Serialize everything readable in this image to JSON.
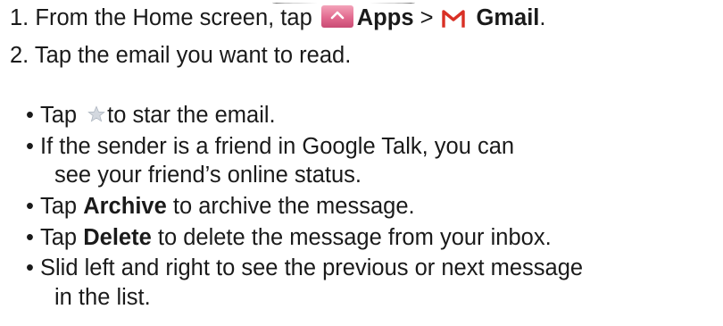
{
  "steps": [
    {
      "number": "1.",
      "text_before": "From the Home screen, tap",
      "apps_label": "Apps",
      "separator": ">",
      "gmail_label": "Gmail",
      "trailing": "."
    },
    {
      "number": "2.",
      "text": "Tap the email you want to read."
    }
  ],
  "tips": {
    "bullet": "•",
    "star": {
      "prefix": "Tap",
      "suffix": "to star the email."
    },
    "friend": {
      "line1": "If the sender is a friend in Google Talk, you can",
      "line2": "see your friend’s online status."
    },
    "archive": {
      "prefix": "Tap",
      "bold": "Archive",
      "suffix": "to archive the message."
    },
    "delete": {
      "prefix": "Tap",
      "bold": "Delete",
      "suffix": "to delete the message from your inbox."
    },
    "slide": {
      "line1": "Slid left and right to see the previous or next message",
      "line2": "in the list."
    }
  },
  "icons": {
    "apps": "apps-icon",
    "gmail": "gmail-icon",
    "star": "star-icon"
  },
  "colors": {
    "text": "#1a1a1a",
    "apps_icon": "#e26a8f",
    "gmail_icon": "#d93025",
    "star_icon": "#c8ced6"
  }
}
